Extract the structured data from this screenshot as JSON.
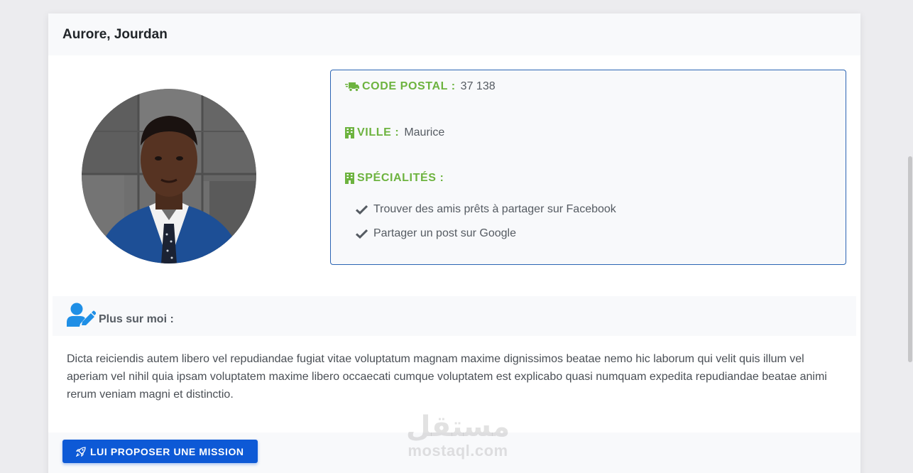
{
  "profile": {
    "name": "Aurore, Jourdan",
    "avatar_alt": "profile-photo"
  },
  "info": {
    "postal_label": "CODE POSTAL :",
    "postal_value": "37 138",
    "city_label": "VILLE :",
    "city_value": "Maurice",
    "specialties_label": "SPÉCIALITÉS :",
    "specialties": [
      "Trouver des amis prêts à partager sur Facebook",
      "Partager un post sur Google"
    ]
  },
  "about": {
    "title": "Plus sur moi :",
    "text": "Dicta reiciendis autem libero vel repudiandae fugiat vitae voluptatum magnam maxime dignissimos beatae nemo hic laborum qui velit quis illum vel aperiam vel nihil quia ipsam voluptatem maxime libero occaecati cumque voluptatem est explicabo quasi numquam expedita repudiandae beatae animi rerum veniam magni et distinctio."
  },
  "actions": {
    "propose_label": "LUI PROPOSER UNE MISSION"
  },
  "watermark": {
    "arabic": "مستقل",
    "latin": "mostaql.com"
  },
  "colors": {
    "accent_green": "#6db33f",
    "primary_blue": "#0d59d6",
    "border_blue": "#2b64b3",
    "icon_blue": "#1f8fe6"
  },
  "icons": {
    "postal": "shipping-fast-icon",
    "city": "building-icon",
    "specialties": "building-icon",
    "check": "check-icon",
    "about": "user-edit-icon",
    "button": "rocket-icon"
  }
}
